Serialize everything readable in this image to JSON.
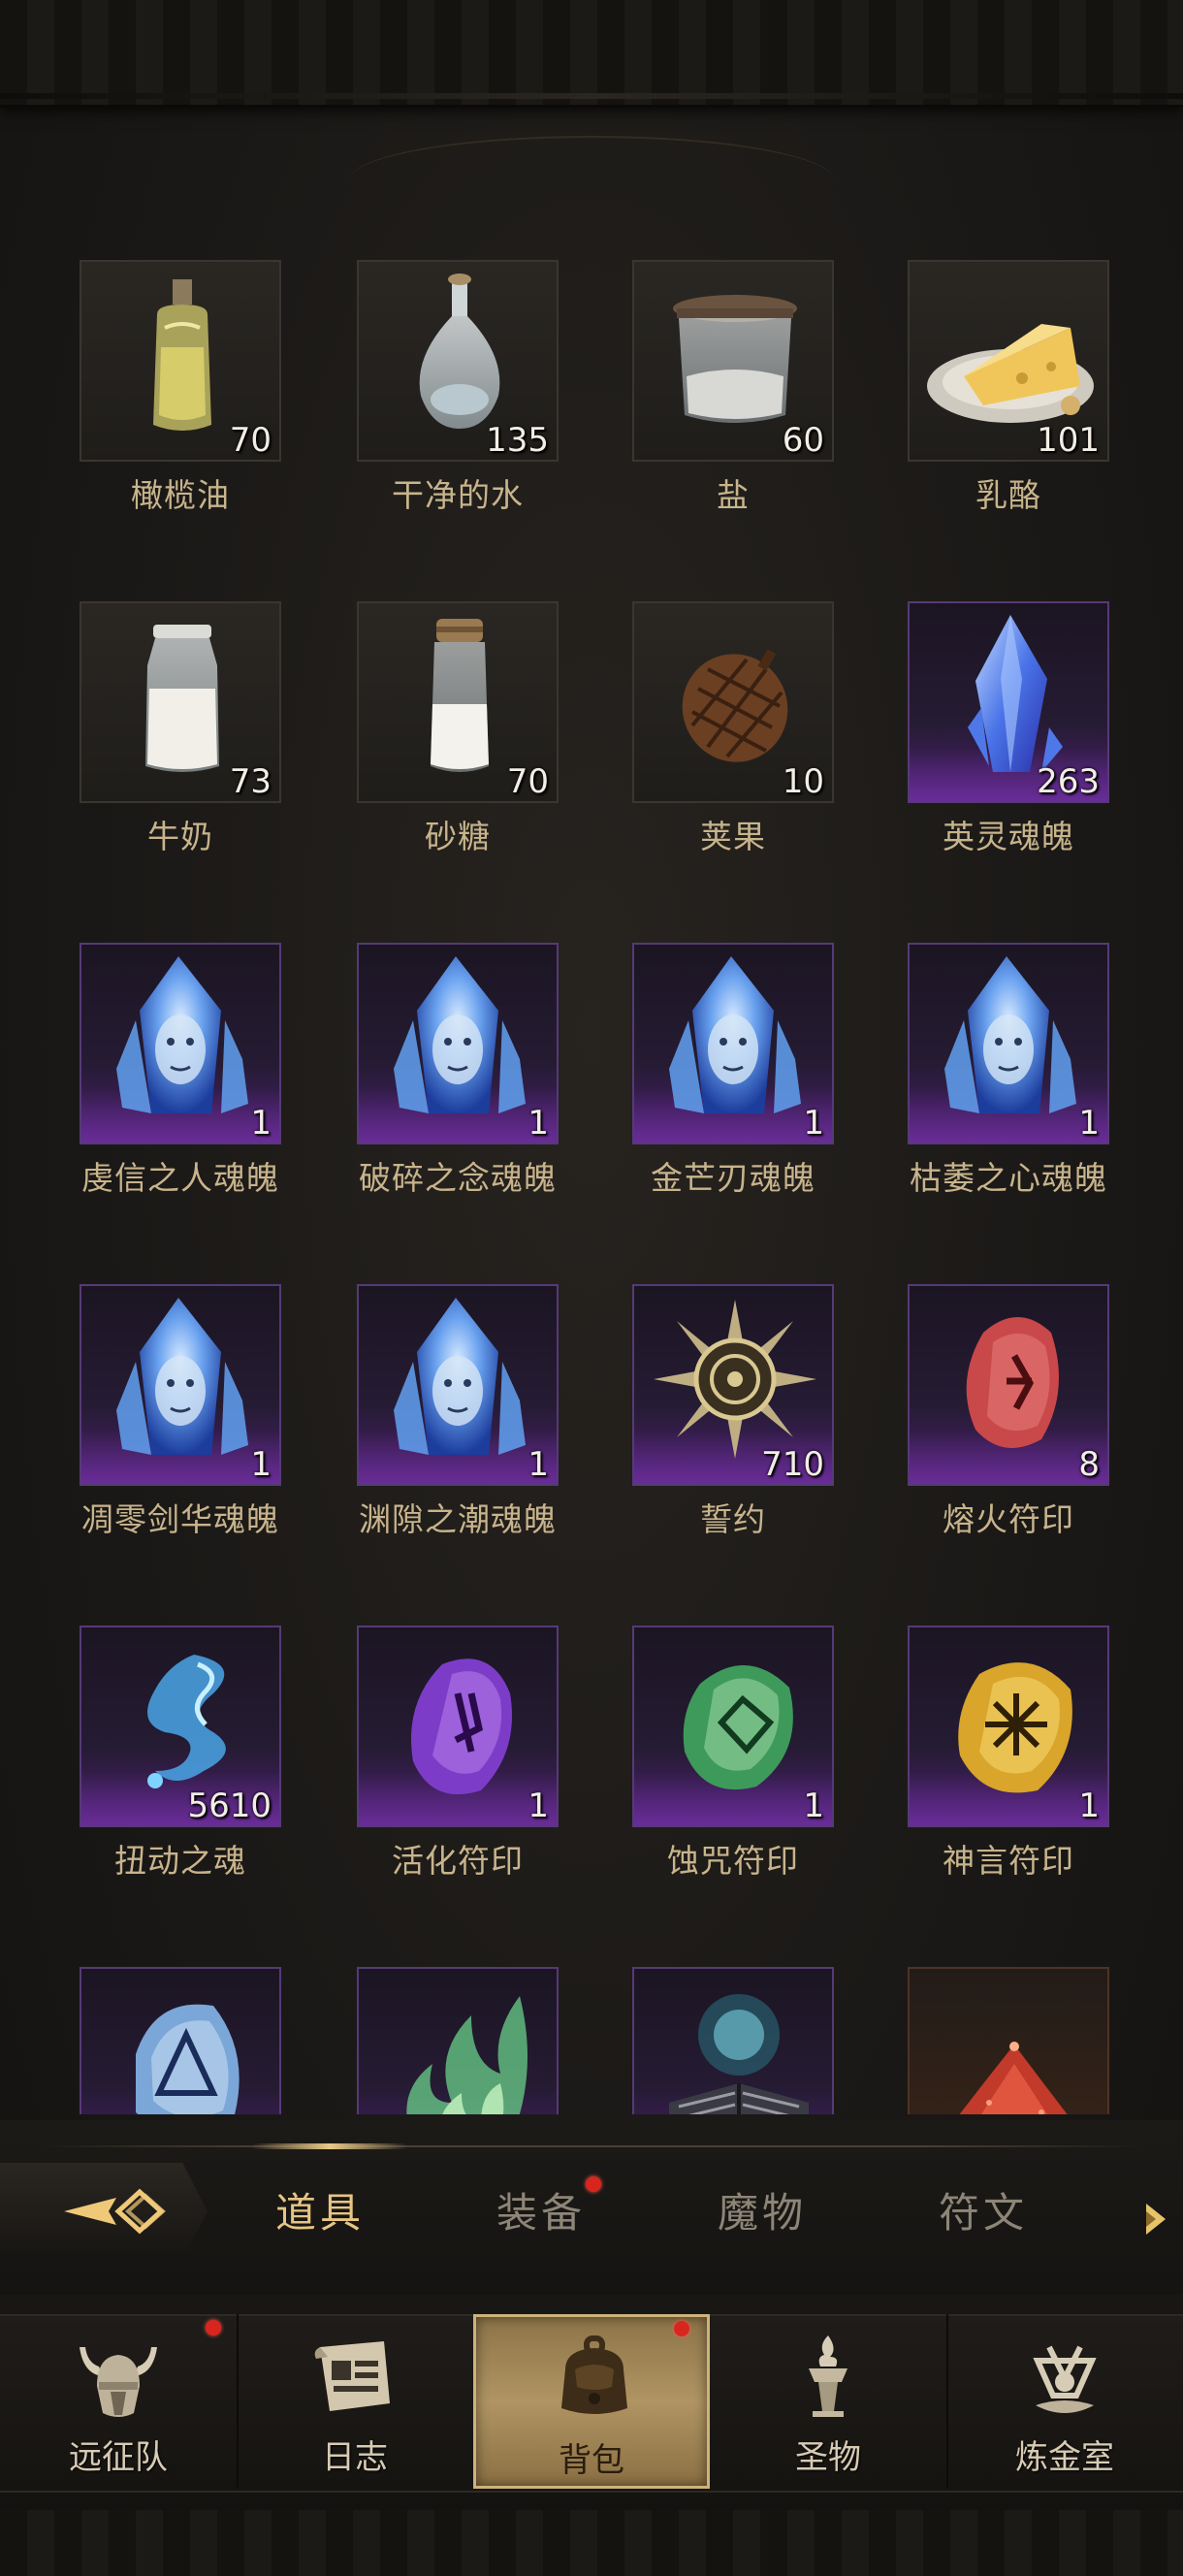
{
  "items": [
    {
      "name": "橄榄油",
      "count": "70",
      "rarity": "normal",
      "icon": "olive-oil-bottle-icon"
    },
    {
      "name": "干净的水",
      "count": "135",
      "rarity": "normal",
      "icon": "water-flask-icon"
    },
    {
      "name": "盐",
      "count": "60",
      "rarity": "normal",
      "icon": "salt-jar-icon"
    },
    {
      "name": "乳酪",
      "count": "101",
      "rarity": "normal",
      "icon": "cheese-plate-icon"
    },
    {
      "name": "牛奶",
      "count": "73",
      "rarity": "normal",
      "icon": "milk-bottle-icon"
    },
    {
      "name": "砂糖",
      "count": "70",
      "rarity": "normal",
      "icon": "sugar-jar-icon"
    },
    {
      "name": "荚果",
      "count": "10",
      "rarity": "normal",
      "icon": "pod-icon"
    },
    {
      "name": "英灵魂魄",
      "count": "263",
      "rarity": "epic",
      "icon": "soul-crystal-icon"
    },
    {
      "name": "虔信之人魂魄",
      "count": "1",
      "rarity": "epic",
      "icon": "soul-crystal-face-icon"
    },
    {
      "name": "破碎之念魂魄",
      "count": "1",
      "rarity": "epic",
      "icon": "soul-crystal-face-icon"
    },
    {
      "name": "金芒刃魂魄",
      "count": "1",
      "rarity": "epic",
      "icon": "soul-crystal-face-icon"
    },
    {
      "name": "枯萎之心魂魄",
      "count": "1",
      "rarity": "epic",
      "icon": "soul-crystal-face-icon"
    },
    {
      "name": "凋零剑华魂魄",
      "count": "1",
      "rarity": "epic",
      "icon": "soul-crystal-face-icon"
    },
    {
      "name": "渊隙之潮魂魄",
      "count": "1",
      "rarity": "epic",
      "icon": "soul-crystal-face-icon"
    },
    {
      "name": "誓约",
      "count": "710",
      "rarity": "epic",
      "icon": "oath-medal-icon"
    },
    {
      "name": "熔火符印",
      "count": "8",
      "rarity": "epic",
      "icon": "red-rune-stone-icon"
    },
    {
      "name": "扭动之魂",
      "count": "5610",
      "rarity": "epic",
      "icon": "blue-wisp-icon"
    },
    {
      "name": "活化符印",
      "count": "1",
      "rarity": "epic",
      "icon": "purple-rune-stone-icon"
    },
    {
      "name": "蚀咒符印",
      "count": "1",
      "rarity": "epic",
      "icon": "green-rune-stone-icon"
    },
    {
      "name": "神言符印",
      "count": "1",
      "rarity": "epic",
      "icon": "yellow-rune-stone-icon"
    },
    {
      "name": "",
      "count": "",
      "rarity": "epic",
      "icon": "blue-rune-stone-icon"
    },
    {
      "name": "",
      "count": "",
      "rarity": "epic",
      "icon": "green-flame-icon"
    },
    {
      "name": "",
      "count": "",
      "rarity": "epic",
      "icon": "spellbook-orb-icon"
    },
    {
      "name": "",
      "count": "",
      "rarity": "legendary",
      "icon": "red-dust-pile-icon"
    }
  ],
  "tabs": [
    {
      "label": "道具",
      "active": true,
      "badge": false
    },
    {
      "label": "装备",
      "active": false,
      "badge": true
    },
    {
      "label": "魔物",
      "active": false,
      "badge": false
    },
    {
      "label": "符文",
      "active": false,
      "badge": false
    }
  ],
  "nav": [
    {
      "label": "远征队",
      "active": false,
      "badge": true,
      "icon": "viking-helmet-icon"
    },
    {
      "label": "日志",
      "active": false,
      "badge": false,
      "icon": "scroll-journal-icon"
    },
    {
      "label": "背包",
      "active": true,
      "badge": true,
      "icon": "backpack-icon"
    },
    {
      "label": "圣物",
      "active": false,
      "badge": false,
      "icon": "holy-torch-icon"
    },
    {
      "label": "炼金室",
      "active": false,
      "badge": false,
      "icon": "alchemy-icon"
    }
  ],
  "colors": {
    "accent": "#e6c584",
    "epic": "#6a3199",
    "badge": "#d8261f",
    "label": "#c8b48c"
  }
}
